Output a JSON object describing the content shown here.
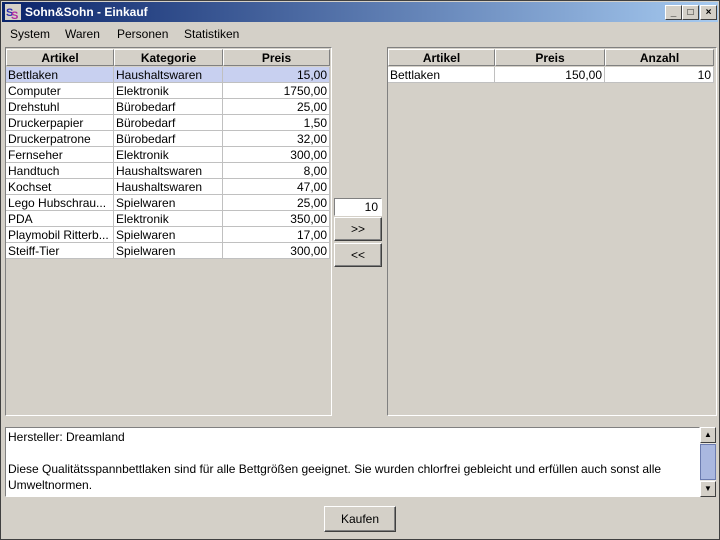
{
  "window": {
    "title": "Sohn&Sohn - Einkauf",
    "controls": {
      "minimize": "_",
      "maximize": "□",
      "close": "×"
    }
  },
  "menu": [
    {
      "label": "System"
    },
    {
      "label": "Waren"
    },
    {
      "label": "Personen"
    },
    {
      "label": "Statistiken"
    }
  ],
  "products": {
    "headers": [
      "Artikel",
      "Kategorie",
      "Preis"
    ],
    "rows": [
      [
        "Bettlaken",
        "Haushaltswaren",
        "15,00"
      ],
      [
        "Computer",
        "Elektronik",
        "1750,00"
      ],
      [
        "Drehstuhl",
        "Bürobedarf",
        "25,00"
      ],
      [
        "Druckerpapier",
        "Bürobedarf",
        "1,50"
      ],
      [
        "Druckerpatrone",
        "Bürobedarf",
        "32,00"
      ],
      [
        "Fernseher",
        "Elektronik",
        "300,00"
      ],
      [
        "Handtuch",
        "Haushaltswaren",
        "8,00"
      ],
      [
        "Kochset",
        "Haushaltswaren",
        "47,00"
      ],
      [
        "Lego Hubschrau...",
        "Spielwaren",
        "25,00"
      ],
      [
        "PDA",
        "Elektronik",
        "350,00"
      ],
      [
        "Playmobil Ritterb...",
        "Spielwaren",
        "17,00"
      ],
      [
        "Steiff-Tier",
        "Spielwaren",
        "300,00"
      ]
    ],
    "selected_row": 0
  },
  "transfer": {
    "quantity": "10",
    "add_label": ">>",
    "remove_label": "<<"
  },
  "cart": {
    "headers": [
      "Artikel",
      "Preis",
      "Anzahl"
    ],
    "rows": [
      [
        "Bettlaken",
        "150,00",
        "10"
      ]
    ]
  },
  "description": {
    "manufacturer": "Hersteller: Dreamland",
    "text": "Diese Qualitätsspannbettlaken sind für alle Bettgrößen geeignet. Sie wurden chlorfrei gebleicht und erfüllen auch sonst alle Umweltnormen."
  },
  "buy_label": "Kaufen",
  "colors": {
    "title_start": "#0a246a",
    "title_end": "#a6caf0",
    "selection": "#c8d0f0"
  }
}
